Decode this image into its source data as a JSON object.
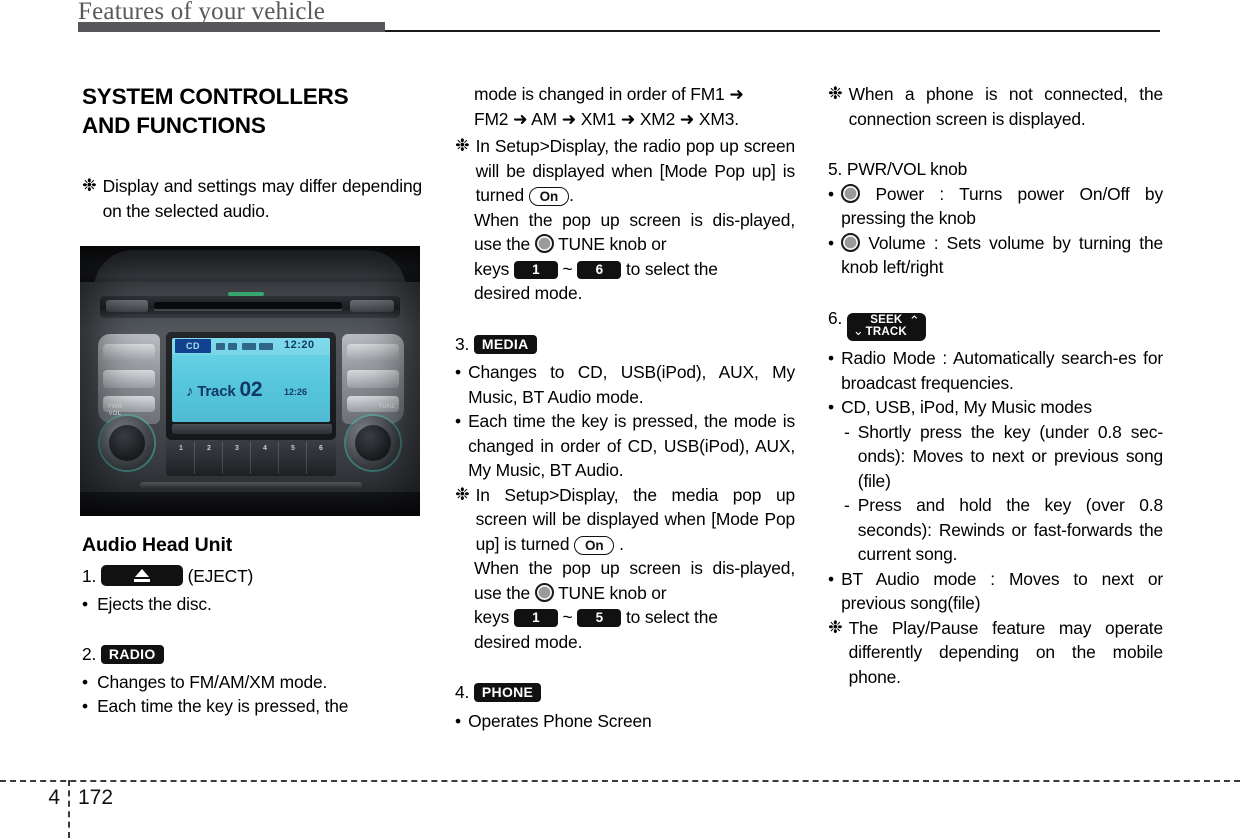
{
  "header": {
    "title": "Features of your vehicle"
  },
  "footer": {
    "chapter": "4",
    "page": "172"
  },
  "left_column": {
    "section_title_line1": "SYSTEM CONTROLLERS",
    "section_title_line2": "AND FUNCTIONS",
    "note_marker": "❉",
    "note_text": "Display and settings may differ depending on the selected audio.",
    "photo": {
      "caption": "Audio head unit front panel photo",
      "screen": {
        "source_tag": "CD",
        "clock": "12:20",
        "track_label": "Track",
        "track_number": "02",
        "elapsed": "12:26",
        "note_icon": "♪"
      },
      "knob_left_label": "PWR\nVOL",
      "knob_right_label": "TUNE",
      "preset_numbers": [
        "1",
        "2",
        "3",
        "4",
        "5",
        "6"
      ]
    },
    "subsection_title": "Audio Head Unit",
    "item1": {
      "number": "1.",
      "badge": "eject-badge",
      "label": "(EJECT)",
      "bullets": [
        {
          "marker": "•",
          "text": "Ejects the disc."
        }
      ]
    },
    "item2": {
      "number": "2.",
      "badge": "RADIO",
      "bullets": [
        {
          "marker": "•",
          "text": "Changes to FM/AM/XM mode."
        },
        {
          "marker": "•",
          "text": "Each time the key is pressed, the"
        }
      ]
    }
  },
  "mid_column": {
    "continued_text_line1": "mode is changed in order of FM1 ➜",
    "continued_text_line2": "FM2 ➜ AM ➜ XM1 ➜ XM2 ➜ XM3.",
    "note_radio": {
      "marker": "❉",
      "text_before_pill": "In Setup>Display, the radio pop up screen will be displayed when [Mode Pop up] is turned ",
      "pill": "On",
      "text_after_pill": ".",
      "sub_text_1": "When the pop up screen is dis-played, use the ",
      "knob_label": "TUNE knob or",
      "keys_label": "keys",
      "key_from": "1",
      "key_tilde": "~",
      "key_to": "6",
      "keys_tail": "to select the",
      "sub_text_2": "desired mode."
    },
    "item3": {
      "number": "3.",
      "badge": "MEDIA",
      "bullets": [
        {
          "marker": "•",
          "text": "Changes to CD, USB(iPod), AUX, My Music, BT Audio mode."
        },
        {
          "marker": "•",
          "text": "Each time the key is pressed, the mode is changed in order of CD, USB(iPod), AUX, My Music, BT Audio."
        }
      ],
      "note": {
        "marker": "❉",
        "text_before_pill": "In Setup>Display, the media pop up screen will be displayed when [Mode Pop up] is turned ",
        "pill": "On",
        "text_after_pill": ".",
        "sub_text_1": "When the pop up screen is dis-played, use the ",
        "knob_label": "TUNE  knob or",
        "keys_label": "keys",
        "key_from": "1",
        "key_tilde": "~",
        "key_to": "5",
        "keys_tail": "to select the",
        "sub_text_2": "desired mode."
      }
    },
    "item4": {
      "number": "4.",
      "badge": "PHONE",
      "bullets": [
        {
          "marker": "•",
          "text": "Operates Phone Screen"
        }
      ]
    }
  },
  "right_column": {
    "note_phone": {
      "marker": "❉",
      "text": "When a phone is not connected, the connection screen is displayed."
    },
    "item5": {
      "number": "5.",
      "title": "PWR/VOL knob",
      "bullets": [
        {
          "marker": "•",
          "icon": "knob-icon",
          "text": "Power : Turns power On/Off by pressing the knob"
        },
        {
          "marker": "•",
          "icon": "knob-icon",
          "text": "Volume : Sets volume by turning the knob left/right"
        }
      ]
    },
    "item6": {
      "number": "6.",
      "badge": {
        "line1": "SEEK",
        "line2": "TRACK",
        "chevron_left": "⌄",
        "chevron_right": "⌃"
      },
      "bullets": [
        {
          "marker": "•",
          "text": "Radio Mode : Automatically search-es for broadcast frequencies."
        },
        {
          "marker": "•",
          "text": "CD, USB, iPod, My Music modes"
        }
      ],
      "subbullets": [
        {
          "marker": "-",
          "text": "Shortly press the key (under 0.8 sec-onds): Moves to next or previous song (file)"
        },
        {
          "marker": "-",
          "text": "Press and hold the key (over 0.8 seconds): Rewinds or fast-forwards the current song."
        }
      ],
      "bullets_after": [
        {
          "marker": "•",
          "text": "BT Audio mode : Moves to next or previous song(file)"
        }
      ],
      "note": {
        "marker": "❉",
        "text": "The Play/Pause feature may operate differently depending on the mobile phone."
      }
    }
  },
  "colors": {
    "header_gray": "#58585a",
    "badge_black": "#111111",
    "lcd_cyan": "#57c6dc",
    "lcd_blue_tag": "#12418f"
  }
}
